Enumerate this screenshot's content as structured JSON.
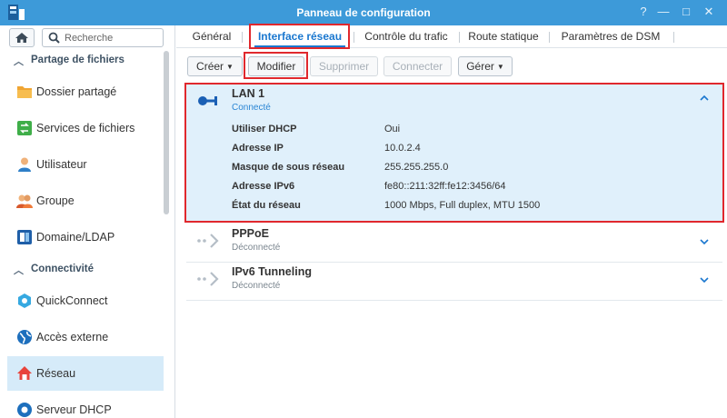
{
  "window": {
    "title": "Panneau de configuration",
    "controls": [
      "?",
      "—",
      "□",
      "✕"
    ]
  },
  "sidebar": {
    "search_placeholder": "Recherche",
    "sections": [
      {
        "label": "Partage de fichiers",
        "items": [
          {
            "label": "Dossier partagé",
            "icon": "folder-icon"
          },
          {
            "label": "Services de fichiers",
            "icon": "file-services-icon"
          },
          {
            "label": "Utilisateur",
            "icon": "user-icon"
          },
          {
            "label": "Groupe",
            "icon": "group-icon"
          },
          {
            "label": "Domaine/LDAP",
            "icon": "domain-icon"
          }
        ]
      },
      {
        "label": "Connectivité",
        "items": [
          {
            "label": "QuickConnect",
            "icon": "quickconnect-icon"
          },
          {
            "label": "Accès externe",
            "icon": "globe-icon"
          },
          {
            "label": "Réseau",
            "icon": "network-home-icon",
            "selected": true
          },
          {
            "label": "Serveur DHCP",
            "icon": "dhcp-icon"
          }
        ]
      }
    ]
  },
  "tabs": [
    {
      "label": "Général"
    },
    {
      "label": "Interface réseau",
      "active": true
    },
    {
      "label": "Contrôle du trafic"
    },
    {
      "label": "Route statique"
    },
    {
      "label": "Paramètres de DSM"
    }
  ],
  "toolbar": {
    "create": "Créer",
    "modify": "Modifier",
    "delete": "Supprimer",
    "connect": "Connecter",
    "manage": "Gérer"
  },
  "interfaces": [
    {
      "name": "LAN 1",
      "status": "Connecté",
      "expanded": true,
      "properties": [
        {
          "label": "Utiliser DHCP",
          "value": "Oui"
        },
        {
          "label": "Adresse IP",
          "value": "10.0.2.4"
        },
        {
          "label": "Masque de sous réseau",
          "value": "255.255.255.0"
        },
        {
          "label": "Adresse IPv6",
          "value": "fe80::211:32ff:fe12:3456/64"
        },
        {
          "label": "État du réseau",
          "value": "1000 Mbps, Full duplex, MTU 1500"
        }
      ]
    },
    {
      "name": "PPPoE",
      "status": "Déconnecté"
    },
    {
      "name": "IPv6 Tunneling",
      "status": "Déconnecté"
    }
  ],
  "colors": {
    "title_bar": "#3d9ad9",
    "accent": "#1a77cf",
    "selected_bg": "#d6ebf9",
    "expanded_bg": "#e0f0fb",
    "highlight": "#e0282d"
  }
}
